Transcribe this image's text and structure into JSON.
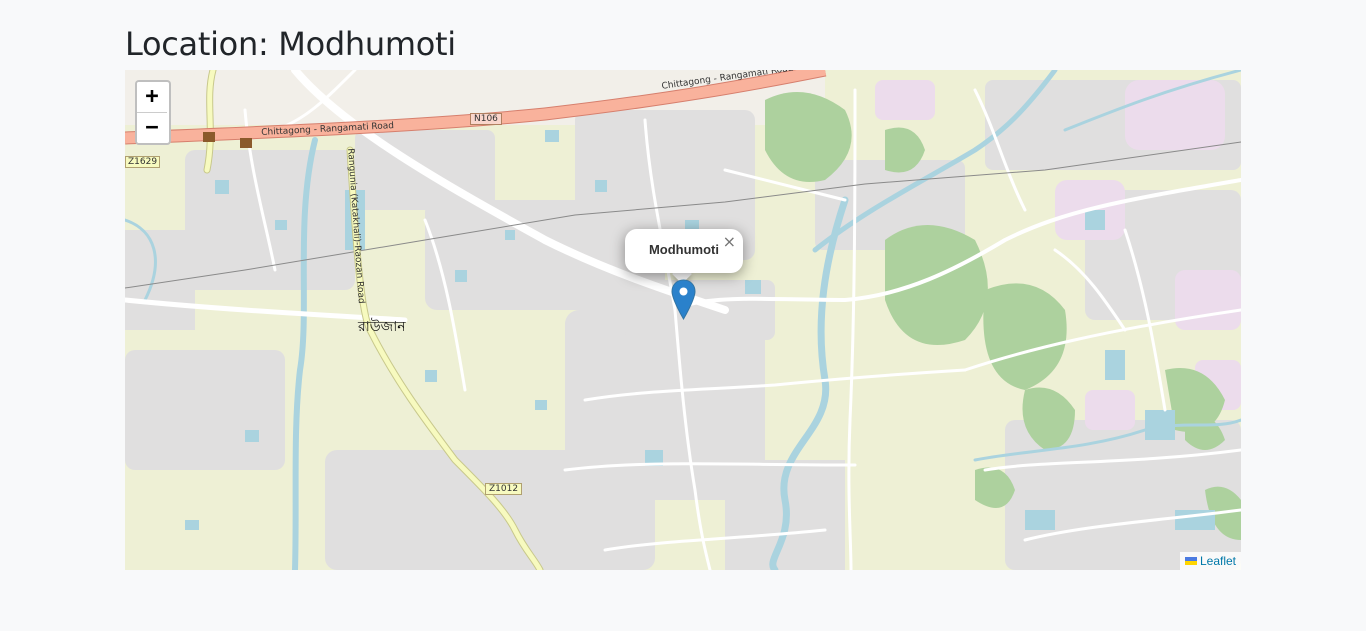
{
  "page": {
    "title": "Location: Modhumoti"
  },
  "map": {
    "zoom_in_label": "+",
    "zoom_out_label": "−",
    "popup": {
      "text": "Modhumoti",
      "close_label": "×"
    },
    "attribution": {
      "link_text": "Leaflet"
    },
    "labels": {
      "road_main_1": "Chittagong - Rangamati Road",
      "road_main_2": "Chittagong - Rangamati Road",
      "route_n106": "N106",
      "route_z1629": "Z1629",
      "route_z1012": "Z1012",
      "road_side": "Rangunia (Katakhali)-Raozan Road",
      "town": "রাউজান"
    },
    "colors": {
      "land": "#f2efe9",
      "farmland": "#eef0d5",
      "residential": "#e0dfdf",
      "building": "#d9d0c9",
      "water": "#aad3df",
      "wood": "#add19e",
      "primary_road": "#fcd6a4",
      "trunk_road": "#f9b29c",
      "secondary_road": "#f7fabf",
      "marker": "#2a81cb"
    }
  }
}
